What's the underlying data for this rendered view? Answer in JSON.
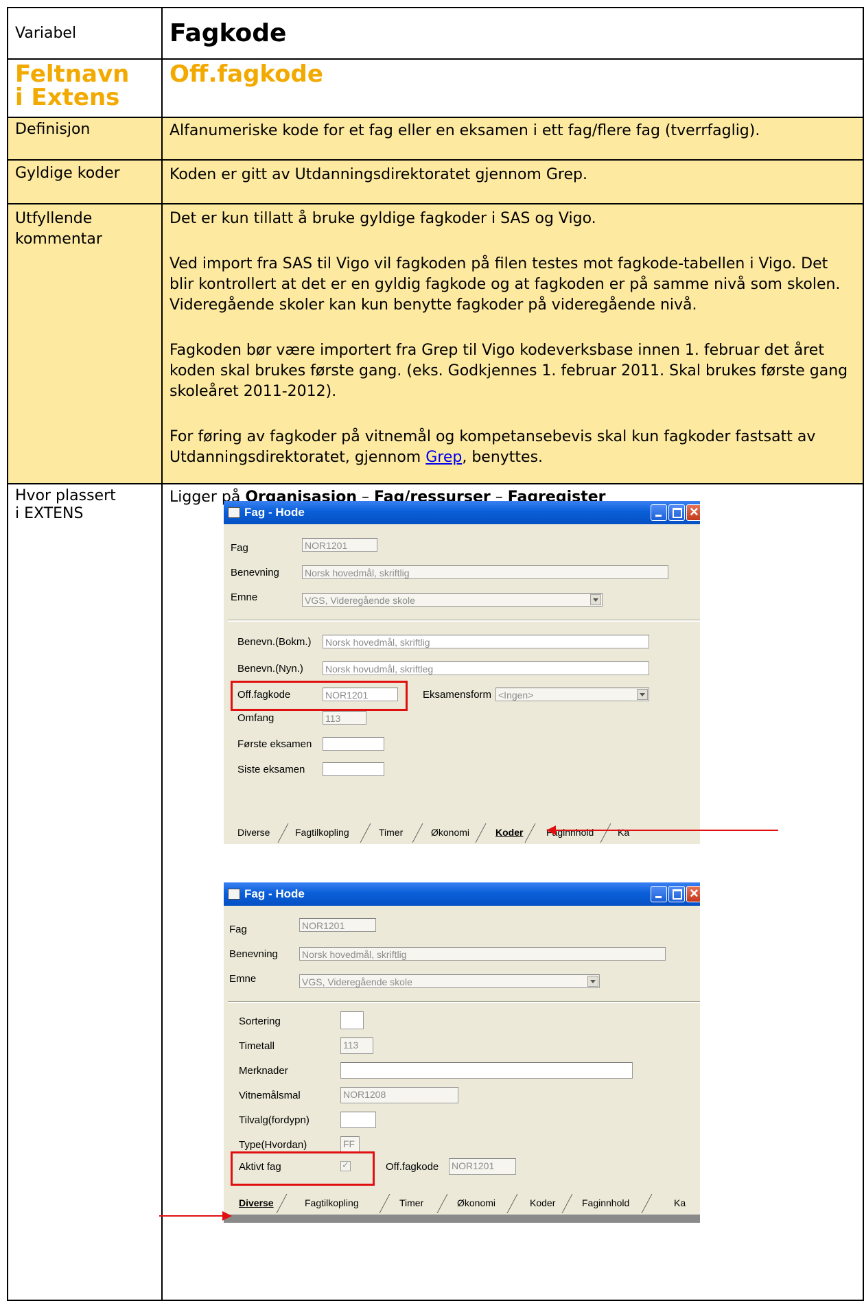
{
  "table": {
    "variable_label": "Variabel",
    "variable_value": "Fagkode",
    "field_label": "Feltnavn i Extens",
    "field_value": "Off.fagkode",
    "definition_label": "Definisjon",
    "definition_text": "Alfanumeriske kode for et fag eller en eksamen i ett fag/flere fag (tverrfaglig).",
    "valid_codes_label": "Gyldige koder",
    "valid_codes_text": "Koden er gitt av Utdanningsdirektoratet gjennom Grep.",
    "comment_label": "Utfyllende kommentar",
    "comment_p1": "Det er kun tillatt å bruke gyldige fagkoder i SAS og Vigo.",
    "comment_p2": "Ved import fra SAS til Vigo vil fagkoden på filen testes mot fagkode-tabellen i Vigo. Det blir kontrollert at det er en gyldig fagkode og at fagkoden er på samme nivå som skolen. Videregående skoler kan kun benytte fagkoder på videregående nivå.",
    "comment_p3": "Fagkoden bør være importert fra Grep til Vigo kodeverksbase innen 1. februar det året koden skal brukes første gang. (eks. Godkjennes 1. februar 2011. Skal brukes første gang skoleåret 2011-2012).",
    "comment_p4_before": "For føring av fagkoder på vitnemål og kompetansebevis skal kun fagkoder fastsatt av Utdanningsdirektoratet, gjennom ",
    "comment_p4_link": "Grep",
    "comment_p4_after": ", benyttes.",
    "location_label": "Hvor plassert i EXTENS",
    "location_prefix": "Ligger på ",
    "location_part1": "Organisasjon",
    "location_sep1": " – ",
    "location_part2": "Fag/ressurser",
    "location_sep2": " – ",
    "location_part3": "Fagregister"
  },
  "dialog1": {
    "title": "Fag - Hode",
    "fag_label": "Fag",
    "fag_value": "NOR1201",
    "benevning_label": "Benevning",
    "benevning_value": "Norsk hovedmål, skriftlig",
    "emne_label": "Emne",
    "emne_value": "VGS, Videregående skole",
    "bokm_label": "Benevn.(Bokm.)",
    "bokm_value": "Norsk hovedmål, skriftlig",
    "nyn_label": "Benevn.(Nyn.)",
    "nyn_value": "Norsk hovudmål, skriftleg",
    "offfagkode_label": "Off.fagkode",
    "offfagkode_value": "NOR1201",
    "eksamensform_label": "Eksamensform",
    "eksamensform_value": "<Ingen>",
    "omfang_label": "Omfang",
    "omfang_value": "113",
    "forste_label": "Første eksamen",
    "siste_label": "Siste eksamen",
    "tabs": [
      "Diverse",
      "Fagtilkopling",
      "Timer",
      "Økonomi",
      "Koder",
      "Faginnhold",
      "Ka"
    ],
    "active_tab": "Koder"
  },
  "dialog2": {
    "title": "Fag - Hode",
    "fag_label": "Fag",
    "fag_value": "NOR1201",
    "benevning_label": "Benevning",
    "benevning_value": "Norsk hovedmål, skriftlig",
    "emne_label": "Emne",
    "emne_value": "VGS, Videregående skole",
    "sortering_label": "Sortering",
    "timetall_label": "Timetall",
    "timetall_value": "113",
    "merknader_label": "Merknader",
    "vitnemalsmal_label": "Vitnemålsmal",
    "vitnemalsmal_value": "NOR1208",
    "tilvalg_label": "Tilvalg(fordypn)",
    "type_label": "Type(Hvordan)",
    "type_value": "FF",
    "aktivt_label": "Aktivt fag",
    "offfagkode_label": "Off.fagkode",
    "offfagkode_value": "NOR1201",
    "tabs": [
      "Diverse",
      "Fagtilkopling",
      "Timer",
      "Økonomi",
      "Koder",
      "Faginnhold",
      "Ka"
    ],
    "active_tab": "Diverse"
  },
  "colors": {
    "row_yellow": "#fde9a0",
    "title_orange": "#f2a900",
    "highlight_red": "#e01010"
  }
}
